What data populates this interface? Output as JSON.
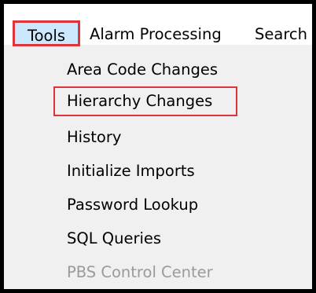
{
  "menubar": {
    "items": [
      {
        "label": "Tools"
      },
      {
        "label": "Alarm Processing"
      },
      {
        "label": "Search"
      }
    ]
  },
  "tools_menu": {
    "items": [
      {
        "label": "Area Code Changes",
        "enabled": true
      },
      {
        "label": "Hierarchy Changes",
        "enabled": true,
        "highlighted": true
      },
      {
        "label": "History",
        "enabled": true
      },
      {
        "label": "Initialize Imports",
        "enabled": true
      },
      {
        "label": "Password Lookup",
        "enabled": true
      },
      {
        "label": "SQL Queries",
        "enabled": true
      },
      {
        "label": "PBS Control Center",
        "enabled": false
      }
    ]
  },
  "colors": {
    "highlight_border": "#e0343b",
    "active_menu_bg": "#cce8ff",
    "menu_bg": "#f0f0f0",
    "disabled_text": "#9a9a9a"
  }
}
